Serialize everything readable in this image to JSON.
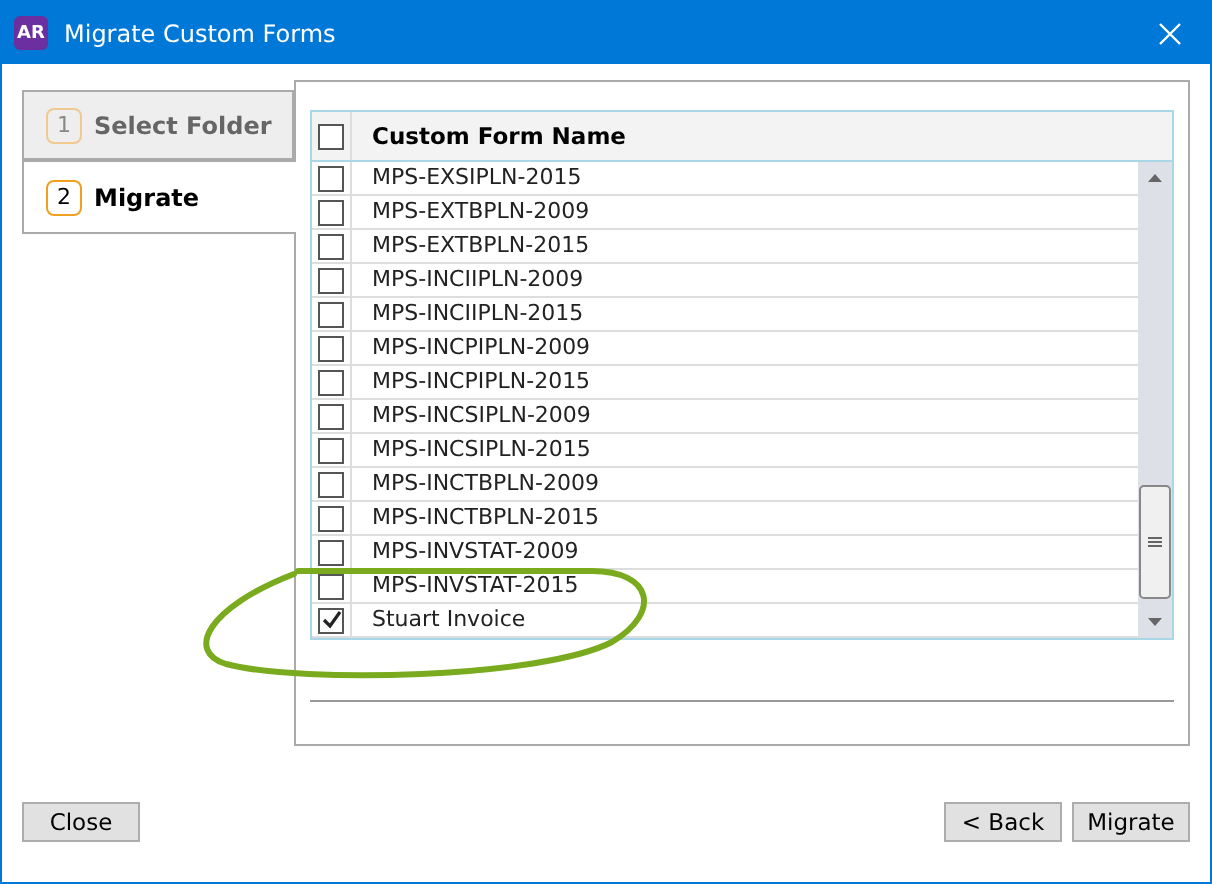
{
  "window": {
    "title": "Migrate Custom Forms",
    "app_badge": "AR"
  },
  "steps": [
    {
      "number": "1",
      "label": "Select Folder",
      "selected": false
    },
    {
      "number": "2",
      "label": "Migrate",
      "selected": true
    }
  ],
  "table": {
    "select_all": {
      "checked": false
    },
    "column": "Custom Form Name",
    "rows": [
      {
        "name": "MPS-EXSIPLN-2015",
        "checked": false
      },
      {
        "name": "MPS-EXTBPLN-2009",
        "checked": false
      },
      {
        "name": "MPS-EXTBPLN-2015",
        "checked": false
      },
      {
        "name": "MPS-INCIIPLN-2009",
        "checked": false
      },
      {
        "name": "MPS-INCIIPLN-2015",
        "checked": false
      },
      {
        "name": "MPS-INCPIPLN-2009",
        "checked": false
      },
      {
        "name": "MPS-INCPIPLN-2015",
        "checked": false
      },
      {
        "name": "MPS-INCSIPLN-2009",
        "checked": false
      },
      {
        "name": "MPS-INCSIPLN-2015",
        "checked": false
      },
      {
        "name": "MPS-INCTBPLN-2009",
        "checked": false
      },
      {
        "name": "MPS-INCTBPLN-2015",
        "checked": false
      },
      {
        "name": "MPS-INVSTAT-2009",
        "checked": false
      },
      {
        "name": "MPS-INVSTAT-2015",
        "checked": false
      },
      {
        "name": "Stuart Invoice",
        "checked": true
      }
    ]
  },
  "buttons": {
    "left": [
      "Close"
    ],
    "right": [
      "< Back",
      "Migrate"
    ]
  }
}
